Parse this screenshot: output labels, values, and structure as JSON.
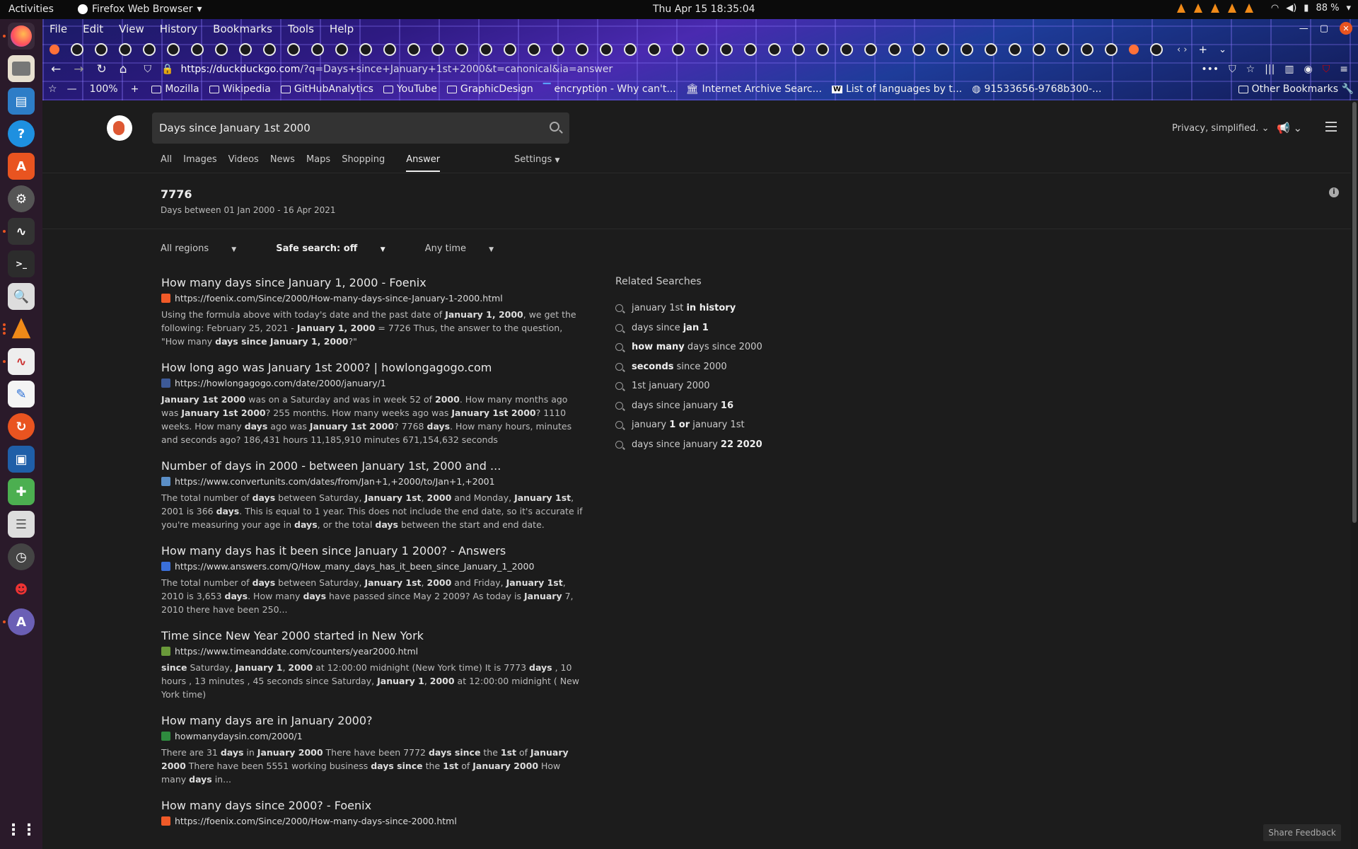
{
  "topbar": {
    "activities": "Activities",
    "app_name": "Firefox Web Browser",
    "clock": "Thu Apr 15  18:35:04",
    "battery": "88 %"
  },
  "menu": [
    "File",
    "Edit",
    "View",
    "History",
    "Bookmarks",
    "Tools",
    "Help"
  ],
  "urlbar": {
    "url_host": "https://duckduckgo.com",
    "url_rest": "/?q=Days+since+January+1st+2000&t=canonical&ia=answer",
    "zoom": "100%"
  },
  "bookmarks": [
    {
      "label": "Mozilla",
      "icon": "folder-icon"
    },
    {
      "label": "Wikipedia",
      "icon": "folder-icon"
    },
    {
      "label": "GitHubAnalytics",
      "icon": "folder-icon"
    },
    {
      "label": "YouTube",
      "icon": "folder-icon"
    },
    {
      "label": "GraphicDesign",
      "icon": "folder-icon"
    },
    {
      "label": "encryption - Why can't...",
      "icon": "stackexchange-icon"
    },
    {
      "label": "Internet Archive Searc...",
      "icon": "archive-icon"
    },
    {
      "label": "List of languages by t...",
      "icon": "wikipedia-icon"
    },
    {
      "label": "91533656-9768b300-...",
      "icon": "globe-icon"
    }
  ],
  "other_bookmarks": "Other Bookmarks",
  "search": {
    "query": "Days since January 1st 2000",
    "tabs": [
      "All",
      "Images",
      "Videos",
      "News",
      "Maps",
      "Shopping"
    ],
    "active_tab": "Answer",
    "settings": "Settings",
    "privacy": "Privacy, simplified."
  },
  "answer": {
    "value": "7776",
    "subtitle": "Days between 01 Jan 2000 - 16 Apr 2021"
  },
  "filters": {
    "region": "All regions",
    "safe_search": "Safe search: off",
    "time": "Any time"
  },
  "results": [
    {
      "title": "How many days since January 1, 2000 - Foenix",
      "url": "https://foenix.com/Since/2000/How-many-days-since-January-1-2000.html",
      "favicon_color": "#f05a28",
      "snippet_html": "Using the formula above with today's date and the past date of <b>January 1, 2000</b>, we get the following: February 25, 2021 - <b>January 1, 2000</b> = 7726 Thus, the answer to the question, \"How many <b>days since January 1, 2000</b>?\""
    },
    {
      "title": "How long ago was January 1st 2000? | howlongagogo.com",
      "url": "https://howlongagogo.com/date/2000/january/1",
      "favicon_color": "#3d5a98",
      "snippet_html": "<b>January 1st 2000</b> was on a Saturday and was in week 52 of <b>2000</b>. How many months ago was <b>January 1st 2000</b>? 255 months. How many weeks ago was <b>January 1st 2000</b>? 1110 weeks. How many <b>days</b> ago was <b>January 1st 2000</b>? 7768 <b>days</b>. How many hours, minutes and seconds ago? 186,431 hours 11,185,910 minutes 671,154,632 seconds"
    },
    {
      "title": "Number of days in 2000 - between January 1st, 2000 and ...",
      "url": "https://www.convertunits.com/dates/from/Jan+1,+2000/to/Jan+1,+2001",
      "favicon_color": "#5b8fc7",
      "snippet_html": "The total number of <b>days</b> between Saturday, <b>January 1st</b>, <b>2000</b> and Monday, <b>January 1st</b>, 2001 is 366 <b>days</b>. This is equal to 1 year. This does not include the end date, so it's accurate if you're measuring your age in <b>days</b>, or the total <b>days</b> between the start and end date."
    },
    {
      "title": "How many days has it been since January 1 2000? - Answers",
      "url": "https://www.answers.com/Q/How_many_days_has_it_been_since_January_1_2000",
      "favicon_color": "#3a6fd8",
      "snippet_html": "The total number of <b>days</b> between Saturday, <b>January 1st</b>, <b>2000</b> and Friday, <b>January 1st</b>, 2010 is 3,653 <b>days</b>. How many <b>days</b> have passed since May 2 2009? As today is <b>January</b> 7, 2010 there have been 250..."
    },
    {
      "title": "Time since New Year 2000 started in New York",
      "url": "https://www.timeanddate.com/counters/year2000.html",
      "favicon_color": "#6a9a3a",
      "snippet_html": "<b>since</b> Saturday, <b>January 1</b>, <b>2000</b> at 12:00:00 midnight (New York time) It is 7773 <b>days</b> , 10 hours , 13 minutes , 45 seconds since Saturday, <b>January 1</b>, <b>2000</b> at 12:00:00 midnight ( New York time)"
    },
    {
      "title": "How many days are in January 2000?",
      "url": "howmanydaysin.com/2000/1",
      "favicon_color": "#2e8b3e",
      "snippet_html": "There are 31 <b>days</b> in <b>January 2000</b> There have been 7772 <b>days since</b> the <b>1st</b> of <b>January 2000</b> There have been 5551 working business <b>days since</b> the <b>1st</b> of <b>January 2000</b> How many <b>days</b> in..."
    },
    {
      "title": "How many days since 2000? - Foenix",
      "url": "https://foenix.com/Since/2000/How-many-days-since-2000.html",
      "favicon_color": "#f05a28",
      "snippet_html": ""
    }
  ],
  "related": {
    "heading": "Related Searches",
    "items": [
      {
        "pre": "january 1st ",
        "bold": "in history",
        "post": ""
      },
      {
        "pre": "days since ",
        "bold": "jan 1",
        "post": ""
      },
      {
        "pre": "",
        "bold": "how many",
        "post": " days since 2000"
      },
      {
        "pre": "",
        "bold": "seconds",
        "post": " since 2000"
      },
      {
        "pre": "1st january 2000",
        "bold": "",
        "post": ""
      },
      {
        "pre": "days since january ",
        "bold": "16",
        "post": ""
      },
      {
        "pre": "january ",
        "bold": "1 or",
        "post": " january 1st"
      },
      {
        "pre": "days since january ",
        "bold": "22 2020",
        "post": ""
      }
    ]
  },
  "feedback": "Share Feedback"
}
